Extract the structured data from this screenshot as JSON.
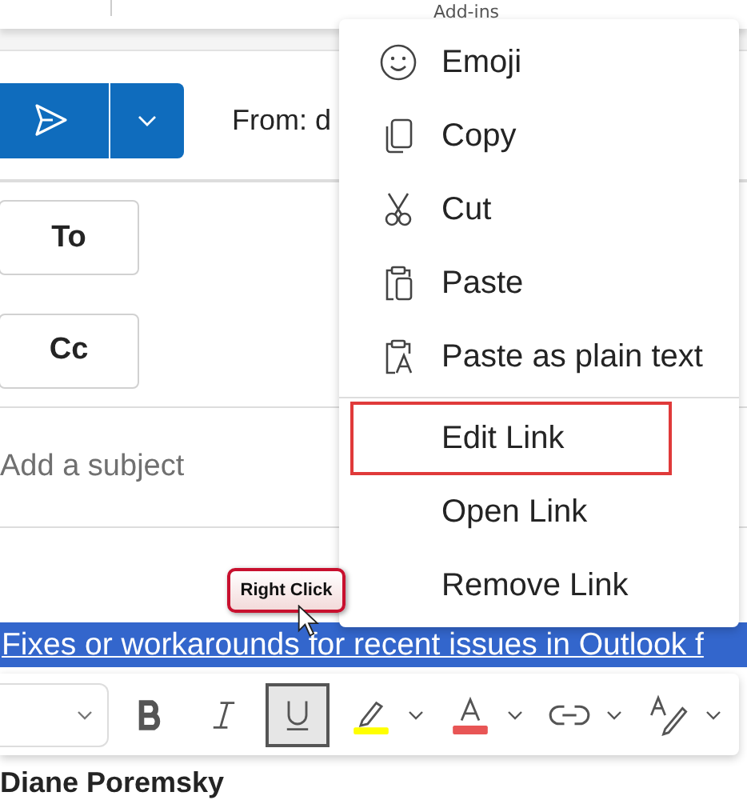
{
  "ribbon": {
    "group_label": "Add-ins"
  },
  "compose": {
    "from_label": "From: d",
    "to_button": "To",
    "cc_button": "Cc",
    "subject": {
      "placeholder": "Add a subject"
    },
    "body_link": "Fixes or workarounds for recent issues in Outlook f",
    "signature": "Diane Poremsky"
  },
  "callout": "Right Click",
  "toolbar": [
    {
      "kind": "bold",
      "selected": false
    },
    {
      "kind": "italic",
      "selected": false
    },
    {
      "kind": "underline",
      "selected": true
    },
    {
      "kind": "highlight",
      "selected": false,
      "color": "#ffff00"
    },
    {
      "kind": "font-color",
      "selected": false,
      "color": "#e85555"
    },
    {
      "kind": "link",
      "selected": false
    },
    {
      "kind": "styles",
      "selected": false
    }
  ],
  "context_menu": [
    {
      "kind": "item",
      "label": "Emoji",
      "highlighted": false
    },
    {
      "kind": "item",
      "label": "Copy",
      "highlighted": false
    },
    {
      "kind": "item",
      "label": "Cut",
      "highlighted": false
    },
    {
      "kind": "item",
      "label": "Paste",
      "highlighted": false
    },
    {
      "kind": "item",
      "label": "Paste as plain text",
      "highlighted": false
    },
    {
      "kind": "separator"
    },
    {
      "kind": "item",
      "label": "Edit Link",
      "highlighted": true
    },
    {
      "kind": "item",
      "label": "Open Link",
      "highlighted": false
    },
    {
      "kind": "item",
      "label": "Remove Link",
      "highlighted": false
    }
  ]
}
